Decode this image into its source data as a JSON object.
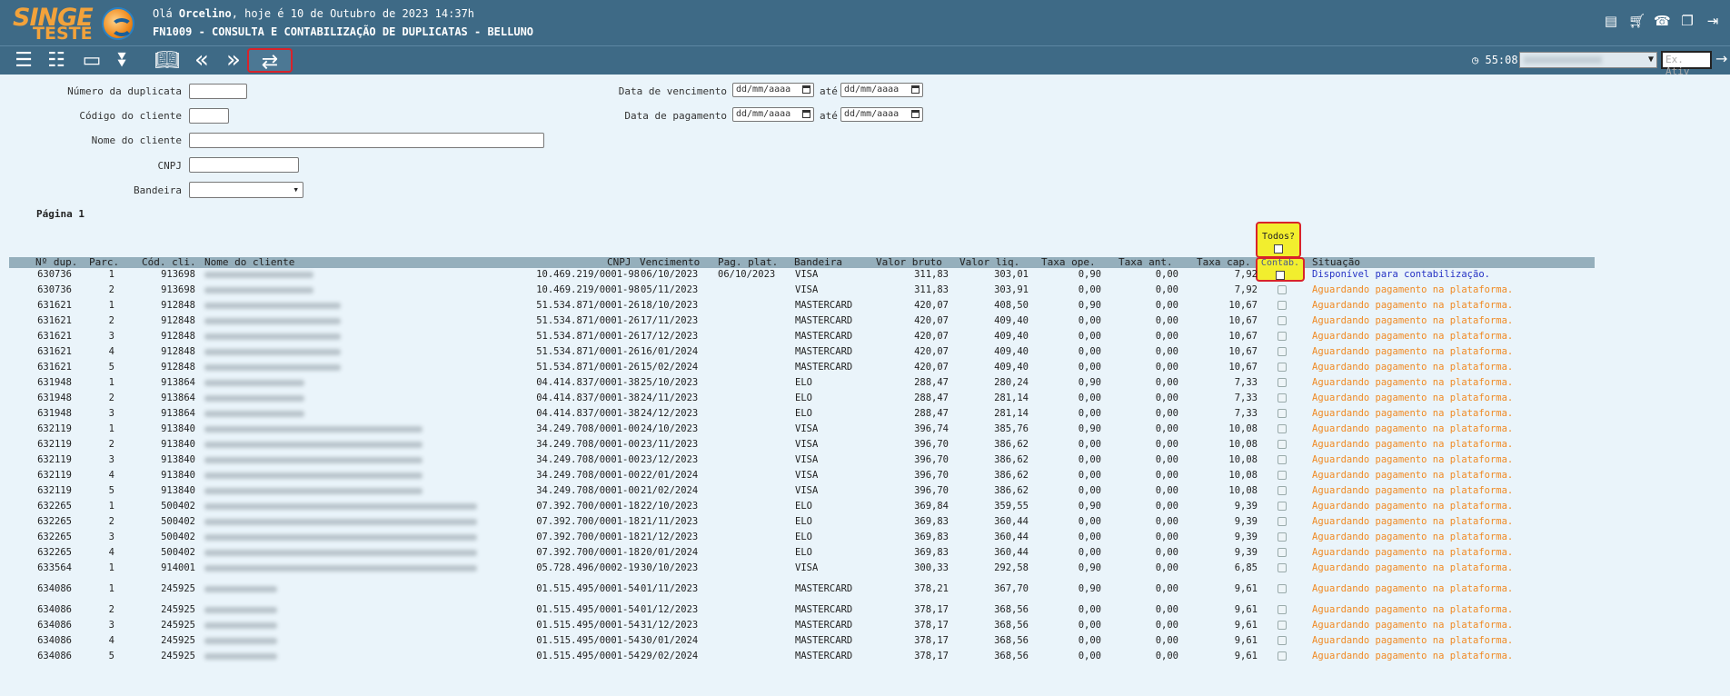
{
  "header": {
    "logo_text": "SINGE",
    "logo_sub": "TESTE",
    "greeting_prefix": "Olá ",
    "user": "Orcelino",
    "greeting_suffix": ", hoje é 10 de Outubro de 2023 14:37h",
    "screen_title": "FN1009 - CONSULTA E CONTABILIZAÇÃO DE DUPLICATAS - BELLUNO",
    "icons": [
      "document-icon",
      "cart-icon",
      "support-chat-icon",
      "window-restore-icon",
      "logout-door-icon"
    ]
  },
  "toolbar": {
    "timer": "55:08",
    "ativ_placeholder": "Ex. Ativ",
    "buttons": [
      "list-icon",
      "list-check-icon",
      "form-list-icon",
      "collapse-all-icon",
      "book-icon",
      "previous-icon",
      "next-icon",
      "refresh-swap-icon"
    ]
  },
  "form": {
    "numero_label": "Número da duplicata",
    "codigo_label": "Código do cliente",
    "nome_label": "Nome do cliente",
    "cnpj_label": "CNPJ",
    "bandeira_label": "Bandeira",
    "vencimento_label": "Data de vencimento",
    "pagamento_label": "Data de pagamento",
    "ate": "até",
    "date_placeholder": "dd/mm/aaaa"
  },
  "pagina": "Página 1",
  "todos_label": "Todos?",
  "columns": {
    "dup": "Nº dup.",
    "parc": "Parc.",
    "codcli": "Cód. cli.",
    "nome": "Nome do cliente",
    "cnpj": "CNPJ",
    "venc": "Vencimento",
    "pag": "Pag. plat.",
    "band": "Bandeira",
    "bruto": "Valor bruto",
    "liq": "Valor liq.",
    "ope": "Taxa ope.",
    "ant": "Taxa ant.",
    "cap": "Taxa cap.",
    "contab": "Contab.",
    "sit": "Situação"
  },
  "rows": [
    {
      "dup": "630736",
      "parc": "1",
      "cod": "913698",
      "cnpj": "10.469.219/0001-98",
      "venc": "06/10/2023",
      "pag": "06/10/2023",
      "band": "VISA",
      "bruto": "311,83",
      "liq": "303,01",
      "ope": "0,90",
      "ant": "0,00",
      "cap": "7,92",
      "sit": "Disponível para contabilização.",
      "ok": true
    },
    {
      "dup": "630736",
      "parc": "2",
      "cod": "913698",
      "cnpj": "10.469.219/0001-98",
      "venc": "05/11/2023",
      "pag": "",
      "band": "VISA",
      "bruto": "311,83",
      "liq": "303,91",
      "ope": "0,00",
      "ant": "0,00",
      "cap": "7,92",
      "sit": "Aguardando pagamento na plataforma."
    },
    {
      "dup": "631621",
      "parc": "1",
      "cod": "912848",
      "cnpj": "51.534.871/0001-26",
      "venc": "18/10/2023",
      "pag": "",
      "band": "MASTERCARD",
      "bruto": "420,07",
      "liq": "408,50",
      "ope": "0,90",
      "ant": "0,00",
      "cap": "10,67",
      "sit": "Aguardando pagamento na plataforma."
    },
    {
      "dup": "631621",
      "parc": "2",
      "cod": "912848",
      "cnpj": "51.534.871/0001-26",
      "venc": "17/11/2023",
      "pag": "",
      "band": "MASTERCARD",
      "bruto": "420,07",
      "liq": "409,40",
      "ope": "0,00",
      "ant": "0,00",
      "cap": "10,67",
      "sit": "Aguardando pagamento na plataforma."
    },
    {
      "dup": "631621",
      "parc": "3",
      "cod": "912848",
      "cnpj": "51.534.871/0001-26",
      "venc": "17/12/2023",
      "pag": "",
      "band": "MASTERCARD",
      "bruto": "420,07",
      "liq": "409,40",
      "ope": "0,00",
      "ant": "0,00",
      "cap": "10,67",
      "sit": "Aguardando pagamento na plataforma."
    },
    {
      "dup": "631621",
      "parc": "4",
      "cod": "912848",
      "cnpj": "51.534.871/0001-26",
      "venc": "16/01/2024",
      "pag": "",
      "band": "MASTERCARD",
      "bruto": "420,07",
      "liq": "409,40",
      "ope": "0,00",
      "ant": "0,00",
      "cap": "10,67",
      "sit": "Aguardando pagamento na plataforma."
    },
    {
      "dup": "631621",
      "parc": "5",
      "cod": "912848",
      "cnpj": "51.534.871/0001-26",
      "venc": "15/02/2024",
      "pag": "",
      "band": "MASTERCARD",
      "bruto": "420,07",
      "liq": "409,40",
      "ope": "0,00",
      "ant": "0,00",
      "cap": "10,67",
      "sit": "Aguardando pagamento na plataforma."
    },
    {
      "dup": "631948",
      "parc": "1",
      "cod": "913864",
      "cnpj": "04.414.837/0001-38",
      "venc": "25/10/2023",
      "pag": "",
      "band": "ELO",
      "bruto": "288,47",
      "liq": "280,24",
      "ope": "0,90",
      "ant": "0,00",
      "cap": "7,33",
      "sit": "Aguardando pagamento na plataforma."
    },
    {
      "dup": "631948",
      "parc": "2",
      "cod": "913864",
      "cnpj": "04.414.837/0001-38",
      "venc": "24/11/2023",
      "pag": "",
      "band": "ELO",
      "bruto": "288,47",
      "liq": "281,14",
      "ope": "0,00",
      "ant": "0,00",
      "cap": "7,33",
      "sit": "Aguardando pagamento na plataforma."
    },
    {
      "dup": "631948",
      "parc": "3",
      "cod": "913864",
      "cnpj": "04.414.837/0001-38",
      "venc": "24/12/2023",
      "pag": "",
      "band": "ELO",
      "bruto": "288,47",
      "liq": "281,14",
      "ope": "0,00",
      "ant": "0,00",
      "cap": "7,33",
      "sit": "Aguardando pagamento na plataforma."
    },
    {
      "dup": "632119",
      "parc": "1",
      "cod": "913840",
      "cnpj": "34.249.708/0001-00",
      "venc": "24/10/2023",
      "pag": "",
      "band": "VISA",
      "bruto": "396,74",
      "liq": "385,76",
      "ope": "0,90",
      "ant": "0,00",
      "cap": "10,08",
      "sit": "Aguardando pagamento na plataforma."
    },
    {
      "dup": "632119",
      "parc": "2",
      "cod": "913840",
      "cnpj": "34.249.708/0001-00",
      "venc": "23/11/2023",
      "pag": "",
      "band": "VISA",
      "bruto": "396,70",
      "liq": "386,62",
      "ope": "0,00",
      "ant": "0,00",
      "cap": "10,08",
      "sit": "Aguardando pagamento na plataforma."
    },
    {
      "dup": "632119",
      "parc": "3",
      "cod": "913840",
      "cnpj": "34.249.708/0001-00",
      "venc": "23/12/2023",
      "pag": "",
      "band": "VISA",
      "bruto": "396,70",
      "liq": "386,62",
      "ope": "0,00",
      "ant": "0,00",
      "cap": "10,08",
      "sit": "Aguardando pagamento na plataforma."
    },
    {
      "dup": "632119",
      "parc": "4",
      "cod": "913840",
      "cnpj": "34.249.708/0001-00",
      "venc": "22/01/2024",
      "pag": "",
      "band": "VISA",
      "bruto": "396,70",
      "liq": "386,62",
      "ope": "0,00",
      "ant": "0,00",
      "cap": "10,08",
      "sit": "Aguardando pagamento na plataforma."
    },
    {
      "dup": "632119",
      "parc": "5",
      "cod": "913840",
      "cnpj": "34.249.708/0001-00",
      "venc": "21/02/2024",
      "pag": "",
      "band": "VISA",
      "bruto": "396,70",
      "liq": "386,62",
      "ope": "0,00",
      "ant": "0,00",
      "cap": "10,08",
      "sit": "Aguardando pagamento na plataforma."
    },
    {
      "dup": "632265",
      "parc": "1",
      "cod": "500402",
      "cnpj": "07.392.700/0001-18",
      "venc": "22/10/2023",
      "pag": "",
      "band": "ELO",
      "bruto": "369,84",
      "liq": "359,55",
      "ope": "0,90",
      "ant": "0,00",
      "cap": "9,39",
      "sit": "Aguardando pagamento na plataforma."
    },
    {
      "dup": "632265",
      "parc": "2",
      "cod": "500402",
      "cnpj": "07.392.700/0001-18",
      "venc": "21/11/2023",
      "pag": "",
      "band": "ELO",
      "bruto": "369,83",
      "liq": "360,44",
      "ope": "0,00",
      "ant": "0,00",
      "cap": "9,39",
      "sit": "Aguardando pagamento na plataforma."
    },
    {
      "dup": "632265",
      "parc": "3",
      "cod": "500402",
      "cnpj": "07.392.700/0001-18",
      "venc": "21/12/2023",
      "pag": "",
      "band": "ELO",
      "bruto": "369,83",
      "liq": "360,44",
      "ope": "0,00",
      "ant": "0,00",
      "cap": "9,39",
      "sit": "Aguardando pagamento na plataforma."
    },
    {
      "dup": "632265",
      "parc": "4",
      "cod": "500402",
      "cnpj": "07.392.700/0001-18",
      "venc": "20/01/2024",
      "pag": "",
      "band": "ELO",
      "bruto": "369,83",
      "liq": "360,44",
      "ope": "0,00",
      "ant": "0,00",
      "cap": "9,39",
      "sit": "Aguardando pagamento na plataforma."
    },
    {
      "dup": "633564",
      "parc": "1",
      "cod": "914001",
      "cnpj": "05.728.496/0002-19",
      "venc": "30/10/2023",
      "pag": "",
      "band": "VISA",
      "bruto": "300,33",
      "liq": "292,58",
      "ope": "0,90",
      "ant": "0,00",
      "cap": "6,85",
      "sit": "Aguardando pagamento na plataforma."
    },
    {
      "dup": "634086",
      "parc": "1",
      "cod": "245925",
      "cnpj": "01.515.495/0001-54",
      "venc": "01/11/2023",
      "pag": "",
      "band": "MASTERCARD",
      "bruto": "378,21",
      "liq": "367,70",
      "ope": "0,90",
      "ant": "0,00",
      "cap": "9,61",
      "sit": "Aguardando pagamento na plataforma."
    },
    {
      "dup": "634086",
      "parc": "2",
      "cod": "245925",
      "cnpj": "01.515.495/0001-54",
      "venc": "01/12/2023",
      "pag": "",
      "band": "MASTERCARD",
      "bruto": "378,17",
      "liq": "368,56",
      "ope": "0,00",
      "ant": "0,00",
      "cap": "9,61",
      "sit": "Aguardando pagamento na plataforma."
    },
    {
      "dup": "634086",
      "parc": "3",
      "cod": "245925",
      "cnpj": "01.515.495/0001-54",
      "venc": "31/12/2023",
      "pag": "",
      "band": "MASTERCARD",
      "bruto": "378,17",
      "liq": "368,56",
      "ope": "0,00",
      "ant": "0,00",
      "cap": "9,61",
      "sit": "Aguardando pagamento na plataforma."
    },
    {
      "dup": "634086",
      "parc": "4",
      "cod": "245925",
      "cnpj": "01.515.495/0001-54",
      "venc": "30/01/2024",
      "pag": "",
      "band": "MASTERCARD",
      "bruto": "378,17",
      "liq": "368,56",
      "ope": "0,00",
      "ant": "0,00",
      "cap": "9,61",
      "sit": "Aguardando pagamento na plataforma."
    },
    {
      "dup": "634086",
      "parc": "5",
      "cod": "245925",
      "cnpj": "01.515.495/0001-54",
      "venc": "29/02/2024",
      "pag": "",
      "band": "MASTERCARD",
      "bruto": "378,17",
      "liq": "368,56",
      "ope": "0,00",
      "ant": "0,00",
      "cap": "9,61",
      "sit": "Aguardando pagamento na plataforma."
    }
  ]
}
